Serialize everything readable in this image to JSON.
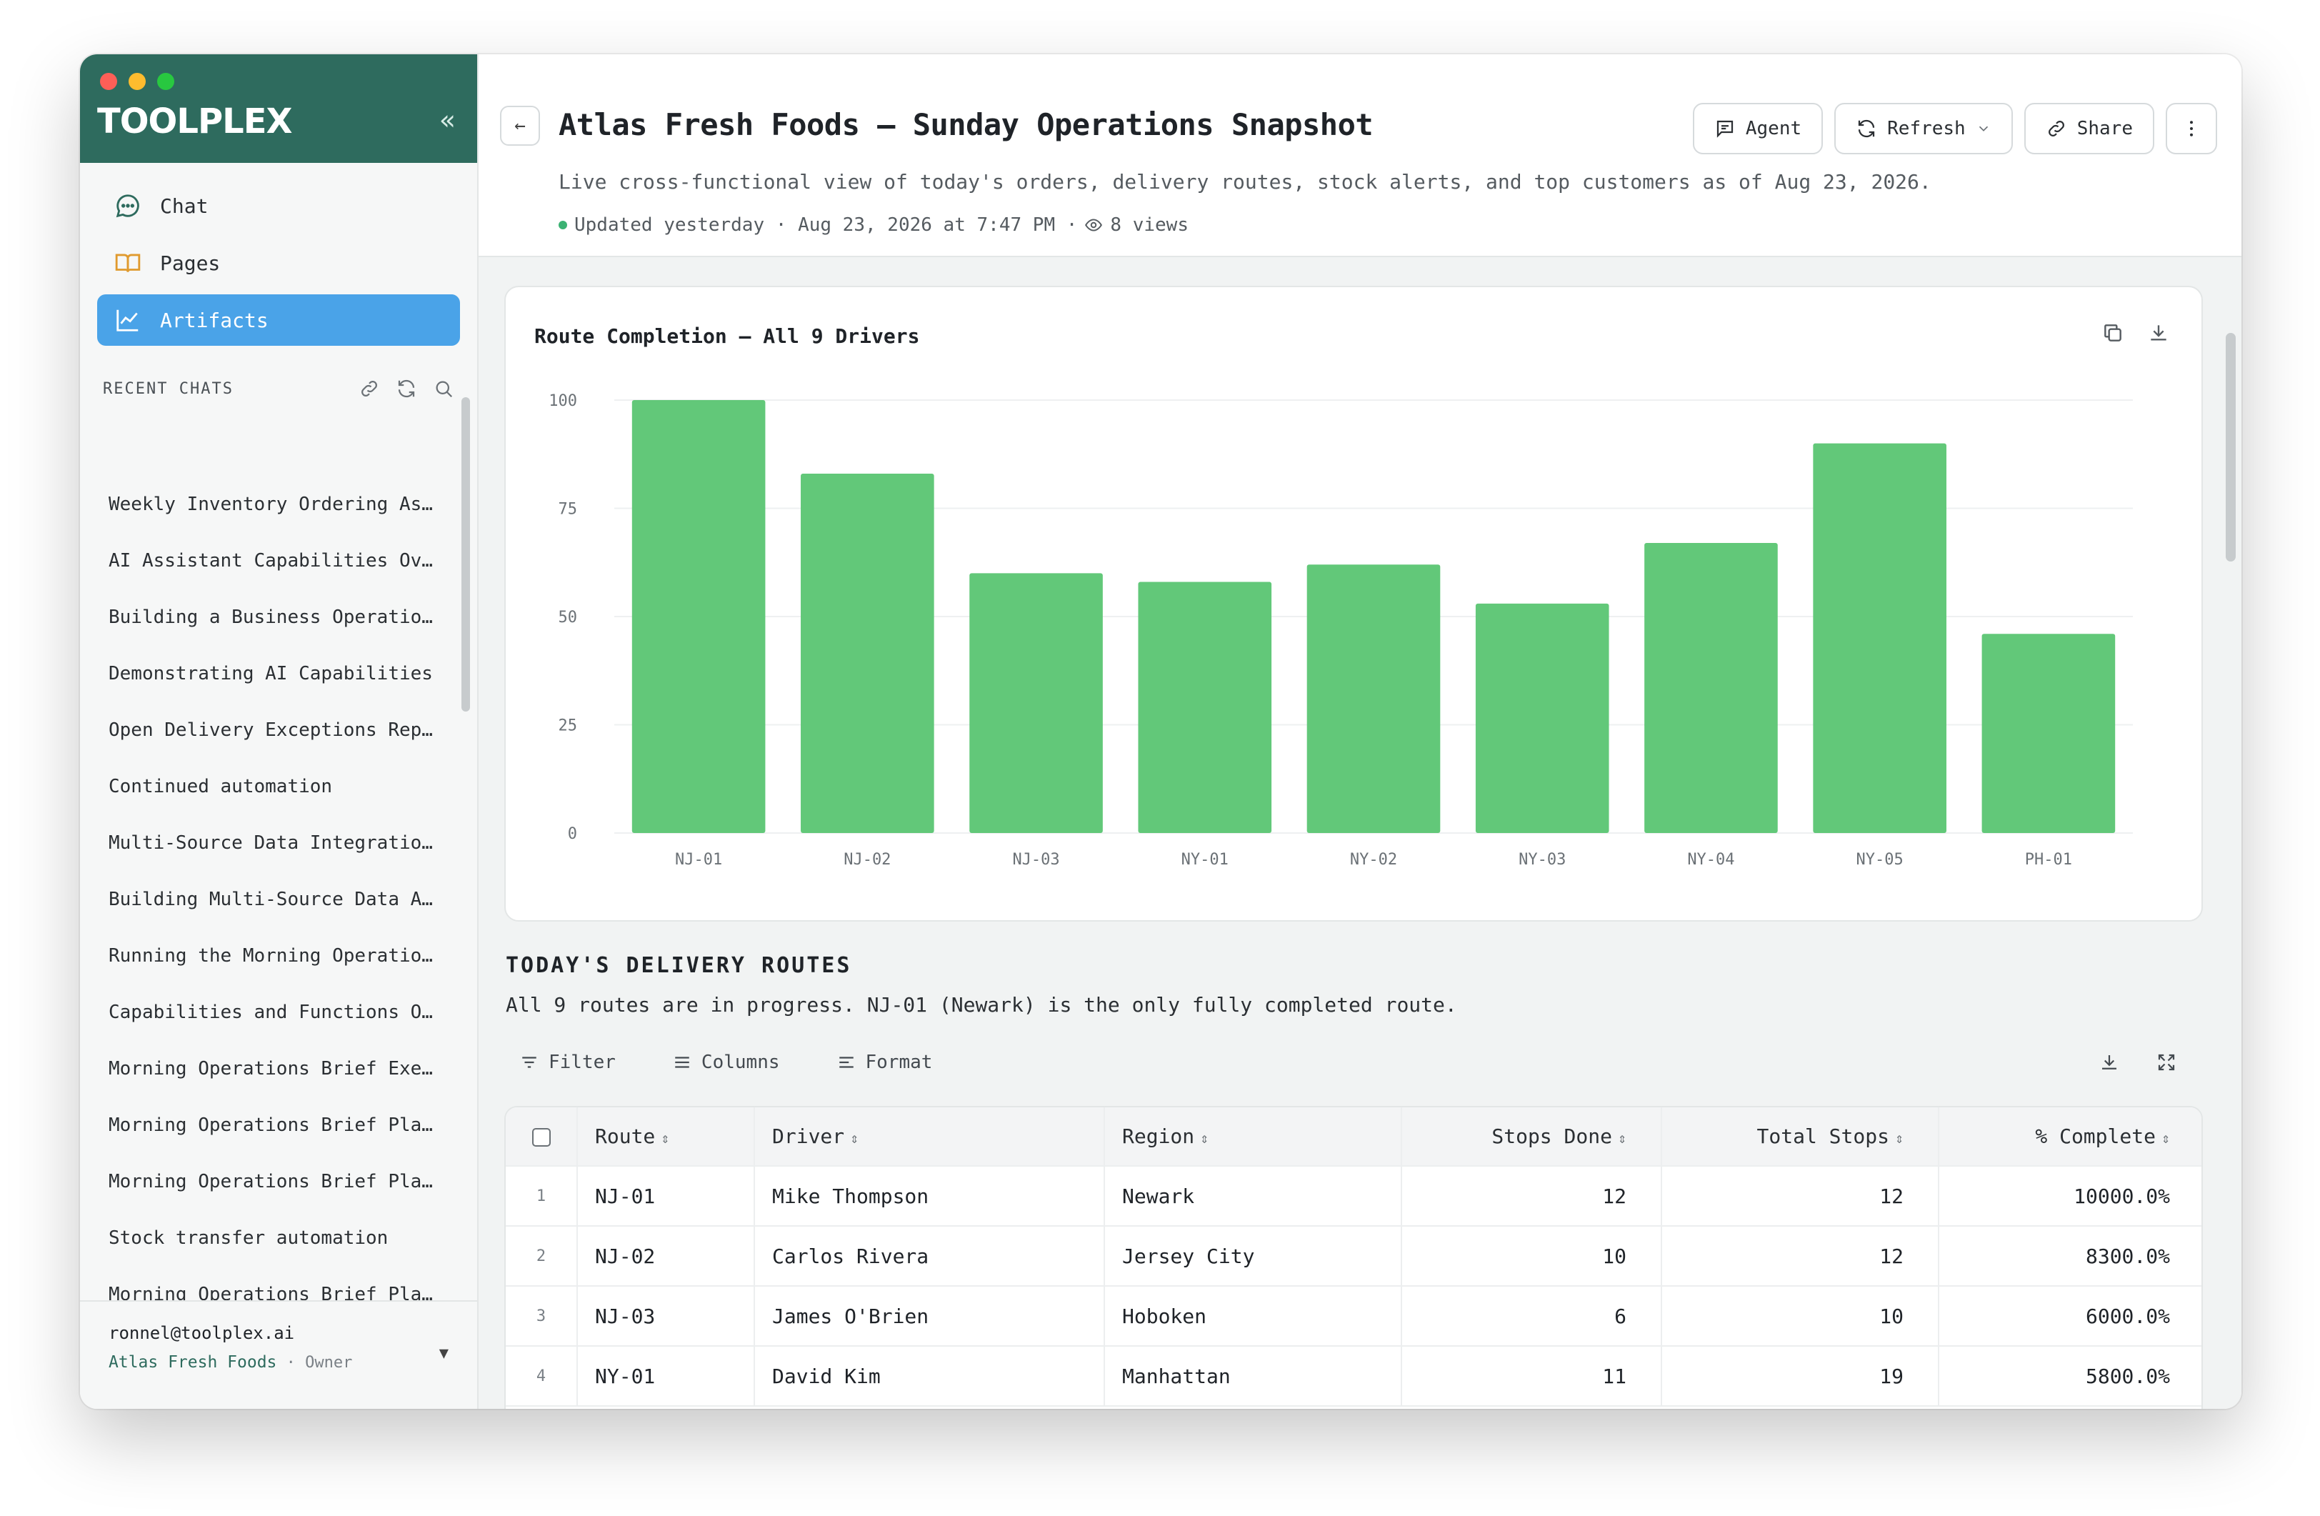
{
  "sidebar": {
    "brand": "TOOLPLEX",
    "collapse_glyph": "«",
    "nav": [
      {
        "label": "Chat",
        "icon": "chat-bubble-icon"
      },
      {
        "label": "Pages",
        "icon": "book-icon"
      },
      {
        "label": "Artifacts",
        "icon": "line-chart-icon"
      }
    ],
    "recent_title": "RECENT CHATS",
    "recent_chats": [
      "Weekly Inventory Ordering As…",
      "AI Assistant Capabilities Ov…",
      "Building a Business Operatio…",
      "Demonstrating AI Capabilities",
      "Open Delivery Exceptions Rep…",
      "Continued automation",
      "Multi-Source Data Integratio…",
      "Building Multi-Source Data A…",
      "Running the Morning Operatio…",
      "Capabilities and Functions O…",
      "Morning Operations Brief Exe…",
      "Morning Operations Brief Pla…",
      "Morning Operations Brief Pla…",
      "Stock transfer automation",
      "Morning Operations Brief Pla…",
      "Morning Operations Brief Pla…"
    ],
    "account": {
      "email": "ronnel@toolplex.ai",
      "org": "Atlas Fresh Foods",
      "separator": " · ",
      "role": "Owner"
    }
  },
  "header": {
    "back_glyph": "←",
    "title": "Atlas Fresh Foods — Sunday Operations Snapshot",
    "subtitle": "Live cross-functional view of today's orders, delivery routes, stock alerts, and top customers as of Aug 23, 2026.",
    "updated": "Updated yesterday · Aug 23, 2026 at 7:47 PM ·",
    "views": "8 views",
    "actions": {
      "agent": "Agent",
      "refresh": "Refresh",
      "share": "Share"
    }
  },
  "chart_data": {
    "type": "bar",
    "title": "Route Completion — All 9 Drivers",
    "categories": [
      "NJ-01",
      "NJ-02",
      "NJ-03",
      "NY-01",
      "NY-02",
      "NY-03",
      "NY-04",
      "NY-05",
      "PH-01"
    ],
    "values": [
      100,
      83,
      60,
      58,
      62,
      53,
      67,
      90,
      46
    ],
    "ylim": [
      0,
      100
    ],
    "yticks": [
      0,
      25,
      50,
      75,
      100
    ],
    "xlabel": "",
    "ylabel": "",
    "bar_color": "#62c879",
    "grid": true
  },
  "routes": {
    "title": "TODAY'S DELIVERY ROUTES",
    "description": "All 9 routes are in progress. NJ-01 (Newark) is the only fully completed route.",
    "tools": {
      "filter": "Filter",
      "columns": "Columns",
      "format": "Format"
    },
    "columns": [
      "Route",
      "Driver",
      "Region",
      "Stops Done",
      "Total Stops",
      "% Complete"
    ],
    "sort_glyph": "⇕",
    "rows": [
      {
        "idx": "1",
        "route": "NJ-01",
        "driver": "Mike Thompson",
        "region": "Newark",
        "done": "12",
        "total": "12",
        "pct": "10000.0%"
      },
      {
        "idx": "2",
        "route": "NJ-02",
        "driver": "Carlos Rivera",
        "region": "Jersey City",
        "done": "10",
        "total": "12",
        "pct": "8300.0%"
      },
      {
        "idx": "3",
        "route": "NJ-03",
        "driver": "James O'Brien",
        "region": "Hoboken",
        "done": "6",
        "total": "10",
        "pct": "6000.0%"
      },
      {
        "idx": "4",
        "route": "NY-01",
        "driver": "David Kim",
        "region": "Manhattan",
        "done": "11",
        "total": "19",
        "pct": "5800.0%"
      }
    ]
  }
}
